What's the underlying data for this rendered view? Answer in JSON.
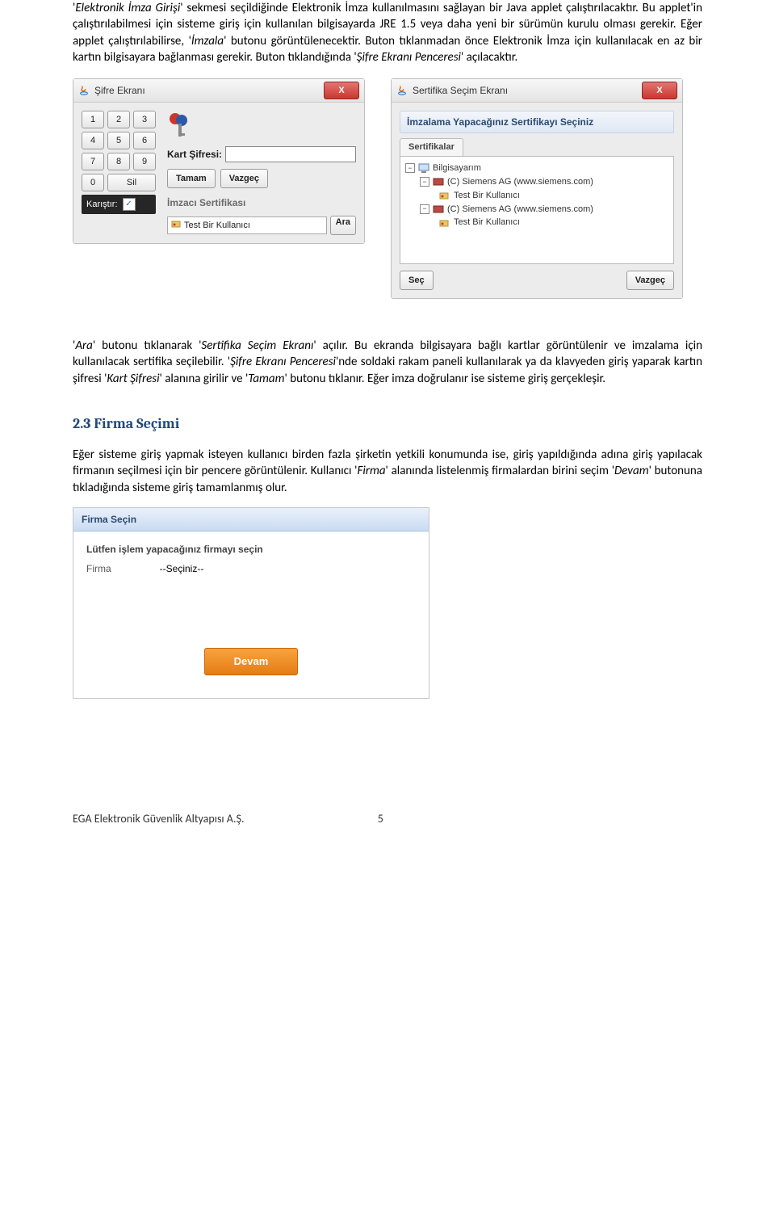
{
  "intro": {
    "p1_pre": "'",
    "p1_em": "Elektronik İmza Girişi",
    "p1_post": "' sekmesi seçildiğinde Elektronik İmza kullanılmasını sağlayan bir Java applet çalıştırılacaktır. Bu applet'in çalıştırılabilmesi için sisteme giriş için kullanılan bilgisayarda JRE 1.5 veya daha yeni bir sürümün kurulu olması gerekir. Eğer applet çalıştırılabilirse, '",
    "p1_em2": "İmzala",
    "p1_post2": "' butonu görüntülenecektir. Buton tıklanmadan önce Elektronik İmza için kullanılacak en az bir kartın bilgisayara bağlanması gerekir. Buton tıklandığında '",
    "p1_em3": "Şifre Ekranı Penceresi",
    "p1_post3": "' açılacaktır."
  },
  "win1": {
    "title": "Şifre Ekranı",
    "keypad": [
      "1",
      "2",
      "3",
      "4",
      "5",
      "6",
      "7",
      "8",
      "9",
      "0",
      "Sil"
    ],
    "karistir_label": "Karıştır:",
    "kart_label": "Kart Şifresi:",
    "btn_ok": "Tamam",
    "btn_cancel": "Vazgeç",
    "imzaci_label": "İmzacı Sertifikası",
    "cert_value": "Test Bir  Kullanıcı",
    "ara": "Ara"
  },
  "win2": {
    "title": "Sertifika Seçim Ekranı",
    "banner": "İmzalama Yapacağınız Sertifikayı Seçiniz",
    "tab": "Sertifikalar",
    "tree": {
      "root": "Bilgisayarım",
      "cert": "(C) Siemens AG (www.siemens.com)",
      "user": "Test Bir  Kullanıcı"
    },
    "btn_select": "Seç",
    "btn_cancel": "Vazgeç"
  },
  "para2": {
    "a": "'",
    "a_em": "Ara",
    "a2": "' butonu tıklanarak '",
    "a_em2": "Sertifika Seçim Ekranı",
    "a3": "' açılır. Bu ekranda bilgisayara bağlı kartlar görüntülenir ve imzalama için kullanılacak sertifika seçilebilir. '",
    "a_em3": "Şifre Ekranı Penceresi",
    "a4": "'nde soldaki rakam paneli kullanılarak ya da klavyeden giriş yaparak kartın şifresi '",
    "a_em4": "Kart Şifresi",
    "a5": "' alanına girilir ve  '",
    "a_em5": "Tamam",
    "a6": "' butonu tıklanır. Eğer imza doğrulanır ise sisteme giriş gerçekleşir."
  },
  "section_title": "2.3 Firma Seçimi",
  "para3": {
    "t1": "Eğer sisteme giriş yapmak isteyen kullanıcı birden fazla şirketin yetkili konumunda ise, giriş yapıldığında adına giriş yapılacak firmanın seçilmesi için bir pencere görüntülenir. Kullanıcı '",
    "t1_em": "Firma",
    "t2": "' alanında listelenmiş firmalardan birini seçim '",
    "t2_em": "Devam",
    "t3": "'  butonuna tıkladığında sisteme giriş tamamlanmış olur."
  },
  "firma": {
    "title": "Firma Seçin",
    "inst": "Lütfen işlem yapacağınız firmayı seçin",
    "label": "Firma",
    "placeholder": "--Seçiniz--",
    "devam": "Devam"
  },
  "footer": {
    "company": "EGA Elektronik Güvenlik Altyapısı A.Ş.",
    "page": "5"
  }
}
